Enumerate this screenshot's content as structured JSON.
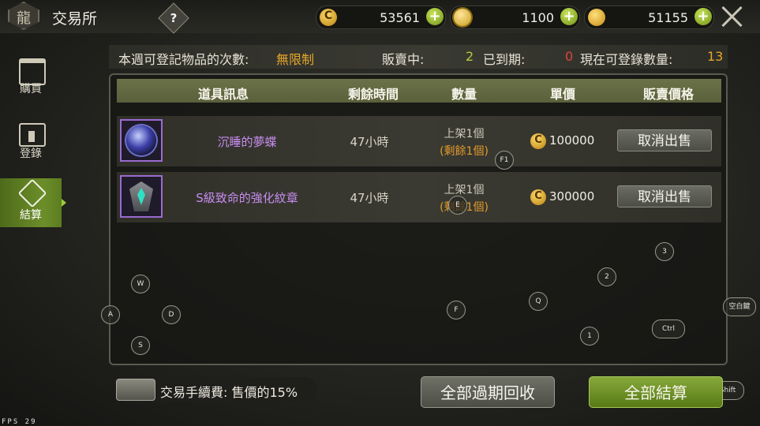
{
  "header": {
    "title": "交易所",
    "help_label": "?",
    "logo_glyph": "龍",
    "currencies": [
      {
        "name": "gold-coin",
        "value": "53561"
      },
      {
        "name": "gold-diamond",
        "value": "1100"
      },
      {
        "name": "coin",
        "value": "51155"
      }
    ],
    "plus_label": "+"
  },
  "nav": {
    "items": [
      {
        "label": "購買",
        "active": false
      },
      {
        "label": "登錄",
        "active": false
      },
      {
        "label": "結算",
        "active": true
      }
    ]
  },
  "stats": {
    "weekly_label": "本週可登記物品的次數:",
    "weekly_value": "無限制",
    "selling_label": "販賣中:",
    "selling_value": "2",
    "expired_label": "已到期:",
    "expired_value": "0",
    "available_label": "現在可登錄數量:",
    "available_value": "13"
  },
  "table": {
    "headers": [
      "道具訊息",
      "剩餘時間",
      "數量",
      "單價",
      "販賣價格"
    ],
    "rows": [
      {
        "name": "沉睡的夢蝶",
        "time": "47小時",
        "qty_listed": "上架1個",
        "qty_left": "(剩餘1個)",
        "price": "100000",
        "action": "取消出售",
        "icon": "dream-butterfly-orb-icon"
      },
      {
        "name": "S級致命的強化紋章",
        "time": "47小時",
        "qty_listed": "上架1個",
        "qty_left": "(剩餘1個)",
        "price": "300000",
        "action": "取消出售",
        "icon": "enhancement-emblem-icon"
      }
    ]
  },
  "key_hints": [
    "F1",
    "W",
    "A",
    "D",
    "S",
    "F",
    "Q",
    "E",
    "1",
    "2",
    "3",
    "Ctrl",
    "空白鍵",
    "Shift"
  ],
  "footer": {
    "fee_label": "交易手續費:",
    "fee_value": "售價的15%",
    "reclaim_label": "全部過期回收",
    "settle_label": "全部結算",
    "fps": "FPS 29"
  },
  "colors": {
    "accent_green": "#6c8e29",
    "orange": "#e6a62a",
    "red": "#e0453b",
    "item_purple": "#c88df0"
  }
}
